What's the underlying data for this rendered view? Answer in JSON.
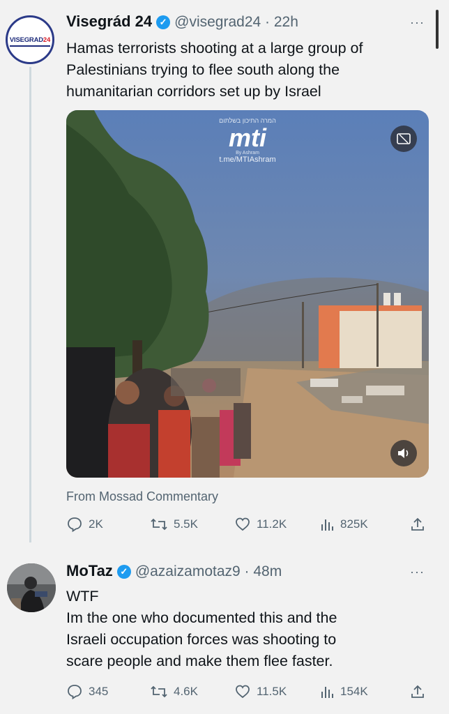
{
  "tweet1": {
    "name": "Visegrád 24",
    "handle": "@visegrad24",
    "time": "22h",
    "avatar_text_a": "VISEGRAD",
    "avatar_text_b": "24",
    "text_lines": [
      "Hamas terrorists shooting at a large group of",
      "Palestinians trying to flee south along the",
      "humanitarian corridors set up by Israel"
    ],
    "media": {
      "watermark_hebrew": "המרה התיכון בשלתום",
      "watermark_logo": "mti",
      "watermark_sub": "By Ashram",
      "watermark_url": "t.me/MTIAshram"
    },
    "source": "From Mossad Commentary",
    "stats": {
      "replies": "2K",
      "reposts": "5.5K",
      "likes": "11.2K",
      "views": "825K"
    }
  },
  "tweet2": {
    "name": "MoTaz",
    "handle": "@azaizamotaz9",
    "time": "48m",
    "text_lines": [
      "WTF",
      "Im the one who documented this and the",
      "Israeli occupation forces was shooting to",
      "scare people and make them flee faster."
    ],
    "stats": {
      "replies": "345",
      "reposts": "4.6K",
      "likes": "11.5K",
      "views": "154K"
    }
  },
  "icons": {
    "verified": "verified-badge-icon",
    "more": "more-icon",
    "reply": "reply-icon",
    "repost": "repost-icon",
    "like": "like-icon",
    "views": "views-icon",
    "share": "share-icon",
    "captions": "captions-icon",
    "volume": "volume-icon"
  },
  "colors": {
    "accent": "#1d9bf0",
    "muted": "#536471",
    "text": "#0f1419",
    "background": "#f2f2f2"
  }
}
